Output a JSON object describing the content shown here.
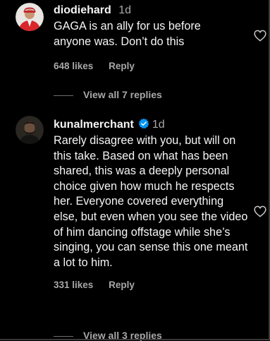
{
  "comments": [
    {
      "username": "diodiehard",
      "time": "1d",
      "verified": false,
      "text": "GAGA is an ally for us before anyone was. Don’t do this",
      "likes": "648 likes",
      "reply": "Reply",
      "view_replies": "View all 7 replies"
    },
    {
      "username": "kunalmerchant",
      "time": "1d",
      "verified": true,
      "text": "Rarely disagree with you, but will on this take. Based on what has been shared, this was a deeply personal choice given how much he respects her. Everyone covered everything else, but even when you see the video of him dancing offstage while she’s singing, you can sense this one meant a lot to him.",
      "likes": "331 likes",
      "reply": "Reply",
      "view_replies": "View all 3 replies"
    }
  ],
  "icons": {
    "like": "heart-outline-icon",
    "verified": "verified-badge-icon"
  },
  "colors": {
    "background": "#000000",
    "text": "#f5f5f5",
    "secondary": "#a8a8a8",
    "verified": "#0095f6"
  }
}
